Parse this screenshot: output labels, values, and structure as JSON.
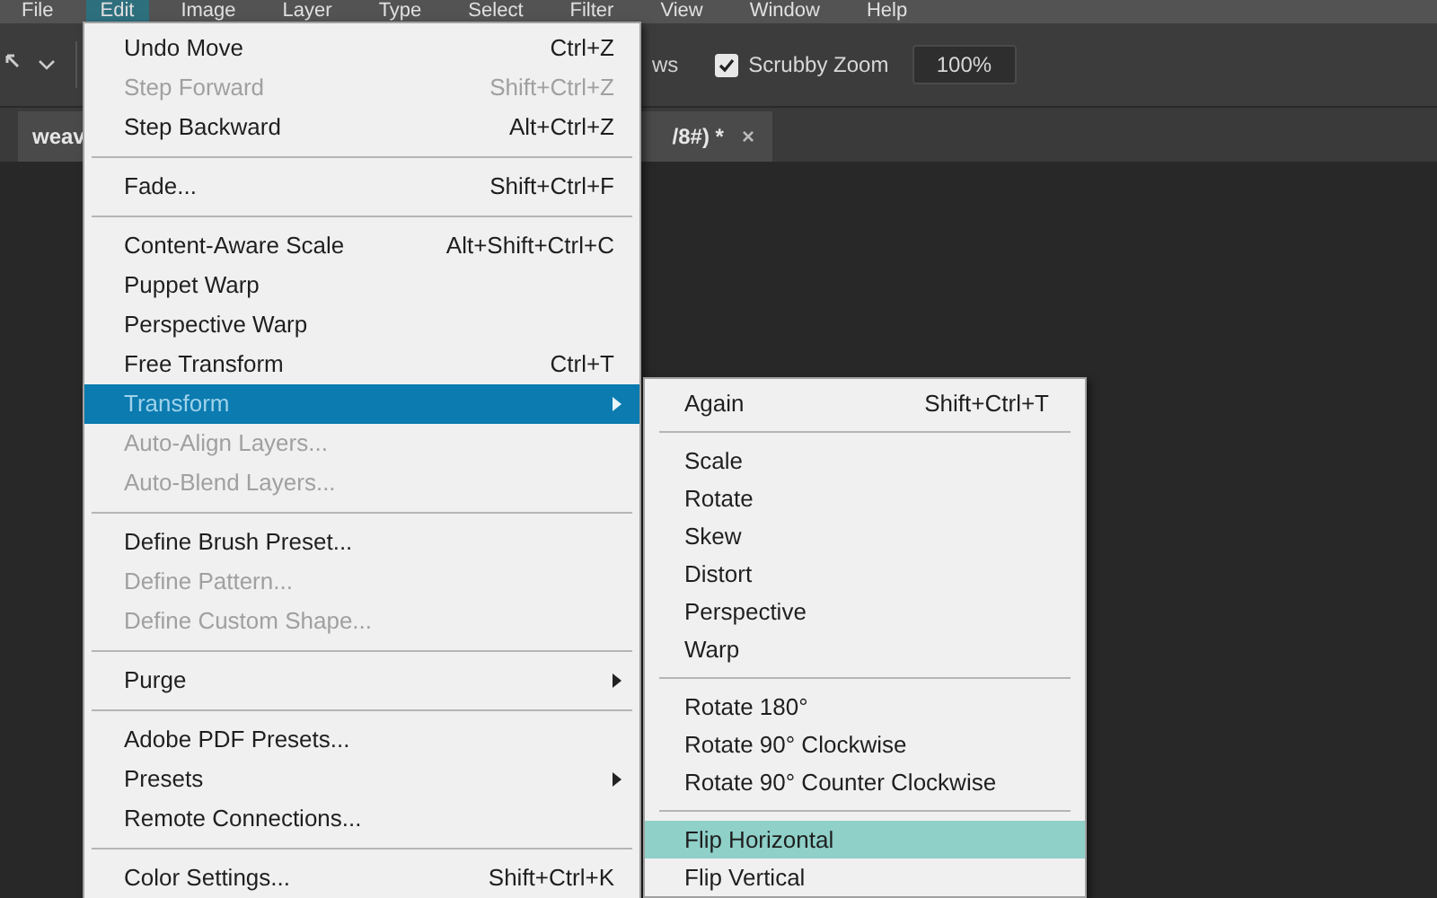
{
  "menu_bar": [
    {
      "label": "File",
      "selected": false
    },
    {
      "label": "Edit",
      "selected": true
    },
    {
      "label": "Image",
      "selected": false
    },
    {
      "label": "Layer",
      "selected": false
    },
    {
      "label": "Type",
      "selected": false
    },
    {
      "label": "Select",
      "selected": false
    },
    {
      "label": "Filter",
      "selected": false
    },
    {
      "label": "View",
      "selected": false
    },
    {
      "label": "Window",
      "selected": false
    },
    {
      "label": "Help",
      "selected": false
    }
  ],
  "options_bar": {
    "partial_label": "ws",
    "scrubby_zoom": {
      "label": "Scrubby Zoom",
      "checked": true
    },
    "zoom_field": {
      "value": "100%"
    }
  },
  "document_tab": {
    "title_start": "weav",
    "title_end": "/8#) *",
    "close": "×"
  },
  "edit_menu": [
    {
      "kind": "item",
      "label": "Undo Move",
      "shortcut": "Ctrl+Z",
      "disabled": false,
      "selected": false,
      "submenu": false
    },
    {
      "kind": "item",
      "label": "Step Forward",
      "shortcut": "Shift+Ctrl+Z",
      "disabled": true,
      "selected": false,
      "submenu": false
    },
    {
      "kind": "item",
      "label": "Step Backward",
      "shortcut": "Alt+Ctrl+Z",
      "disabled": false,
      "selected": false,
      "submenu": false
    },
    {
      "kind": "separator"
    },
    {
      "kind": "item",
      "label": "Fade...",
      "shortcut": "Shift+Ctrl+F",
      "disabled": false,
      "selected": false,
      "submenu": false
    },
    {
      "kind": "separator"
    },
    {
      "kind": "item",
      "label": "Content-Aware Scale",
      "shortcut": "Alt+Shift+Ctrl+C",
      "disabled": false,
      "selected": false,
      "submenu": false
    },
    {
      "kind": "item",
      "label": "Puppet Warp",
      "disabled": false,
      "selected": false,
      "submenu": false
    },
    {
      "kind": "item",
      "label": "Perspective Warp",
      "disabled": false,
      "selected": false,
      "submenu": false
    },
    {
      "kind": "item",
      "label": "Free Transform",
      "shortcut": "Ctrl+T",
      "disabled": false,
      "selected": false,
      "submenu": false
    },
    {
      "kind": "item",
      "label": "Transform",
      "disabled": false,
      "selected": true,
      "submenu": true
    },
    {
      "kind": "item",
      "label": "Auto-Align Layers...",
      "disabled": true,
      "selected": false,
      "submenu": false
    },
    {
      "kind": "item",
      "label": "Auto-Blend Layers...",
      "disabled": true,
      "selected": false,
      "submenu": false
    },
    {
      "kind": "separator"
    },
    {
      "kind": "item",
      "label": "Define Brush Preset...",
      "disabled": false,
      "selected": false,
      "submenu": false
    },
    {
      "kind": "item",
      "label": "Define Pattern...",
      "disabled": true,
      "selected": false,
      "submenu": false
    },
    {
      "kind": "item",
      "label": "Define Custom Shape...",
      "disabled": true,
      "selected": false,
      "submenu": false
    },
    {
      "kind": "separator"
    },
    {
      "kind": "item",
      "label": "Purge",
      "disabled": false,
      "selected": false,
      "submenu": true
    },
    {
      "kind": "separator"
    },
    {
      "kind": "item",
      "label": "Adobe PDF Presets...",
      "disabled": false,
      "selected": false,
      "submenu": false
    },
    {
      "kind": "item",
      "label": "Presets",
      "disabled": false,
      "selected": false,
      "submenu": true
    },
    {
      "kind": "item",
      "label": "Remote Connections...",
      "disabled": false,
      "selected": false,
      "submenu": false
    },
    {
      "kind": "separator"
    },
    {
      "kind": "item",
      "label": "Color Settings...",
      "shortcut": "Shift+Ctrl+K",
      "disabled": false,
      "selected": false,
      "submenu": false
    }
  ],
  "transform_submenu": [
    {
      "kind": "item",
      "label": "Again",
      "shortcut": "Shift+Ctrl+T",
      "selected": false
    },
    {
      "kind": "separator"
    },
    {
      "kind": "item",
      "label": "Scale",
      "selected": false
    },
    {
      "kind": "item",
      "label": "Rotate",
      "selected": false
    },
    {
      "kind": "item",
      "label": "Skew",
      "selected": false
    },
    {
      "kind": "item",
      "label": "Distort",
      "selected": false
    },
    {
      "kind": "item",
      "label": "Perspective",
      "selected": false
    },
    {
      "kind": "item",
      "label": "Warp",
      "selected": false
    },
    {
      "kind": "separator"
    },
    {
      "kind": "item",
      "label": "Rotate 180°",
      "selected": false
    },
    {
      "kind": "item",
      "label": "Rotate 90° Clockwise",
      "selected": false
    },
    {
      "kind": "item",
      "label": "Rotate 90° Counter Clockwise",
      "selected": false
    },
    {
      "kind": "separator"
    },
    {
      "kind": "item",
      "label": "Flip Horizontal",
      "selected": true
    },
    {
      "kind": "item",
      "label": "Flip Vertical",
      "selected": false
    }
  ]
}
